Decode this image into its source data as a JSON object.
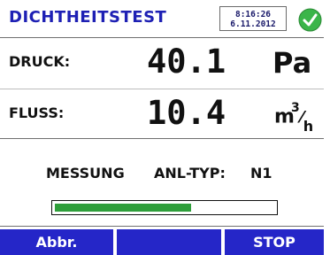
{
  "header": {
    "title": "DICHTHEITSTEST",
    "time": "8:16:26",
    "date": "6.11.2012",
    "status_icon": "check-circle-icon",
    "status_color": "#3bb54a"
  },
  "measurements": {
    "pressure": {
      "label": "DRUCK:",
      "value": "40.1",
      "unit": "Pa"
    },
    "flow": {
      "label": "FLUSS:",
      "value": "10.4",
      "unit_base": "m",
      "unit_sup": "3",
      "unit_den": "h"
    }
  },
  "status": {
    "mode": "MESSUNG",
    "type_label": "ANL-TYP:",
    "type_value": "N1",
    "progress": 0.62,
    "progress_color": "#2e9e3a"
  },
  "softkeys": {
    "left": "Abbr.",
    "middle": "",
    "right": "STOP",
    "color": "#2526c8"
  }
}
